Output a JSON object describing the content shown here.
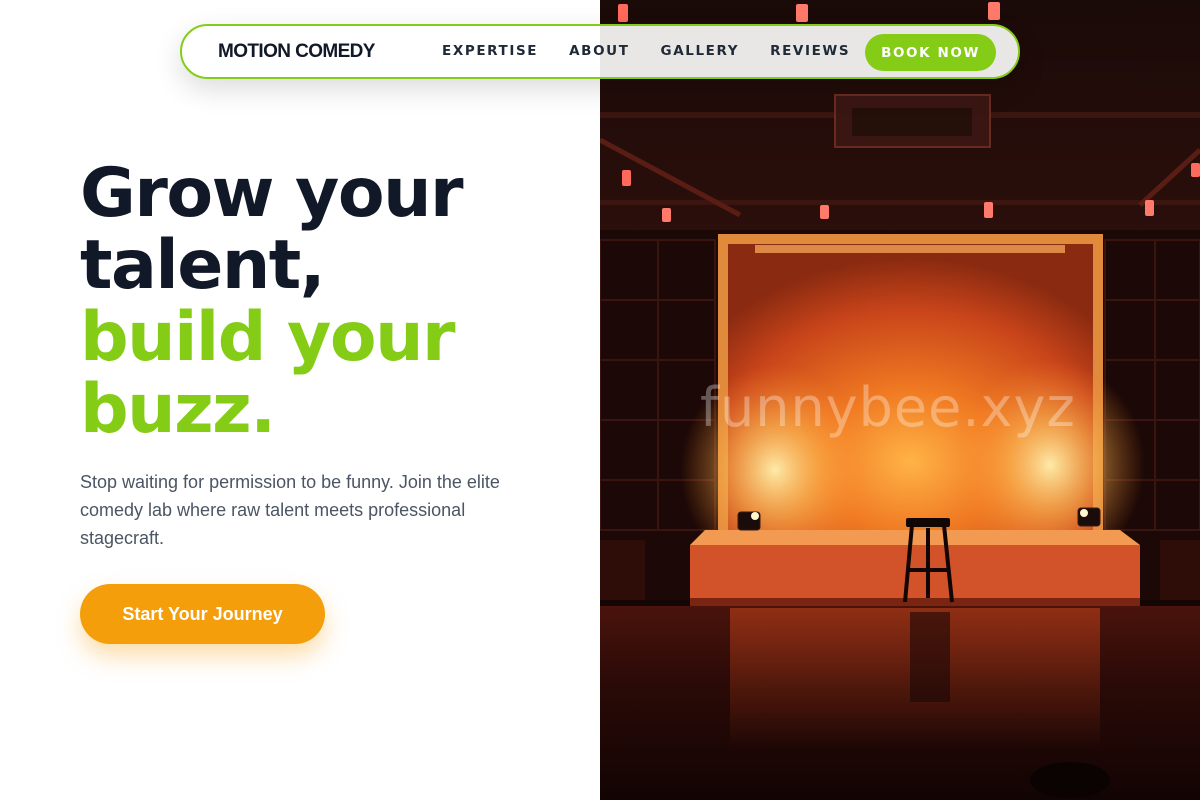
{
  "brand": {
    "name": "MOTION COMEDY"
  },
  "nav": {
    "links": [
      "EXPERTISE",
      "ABOUT",
      "GALLERY",
      "REVIEWS"
    ],
    "cta_label": "BOOK NOW"
  },
  "hero": {
    "headline_lines": [
      "Grow your",
      "talent,",
      "build your",
      "buzz."
    ],
    "highlight_color": "#84cc16",
    "subtext": "Stop waiting for permission to be funny. Join the elite comedy lab where raw talent meets professional stagecraft.",
    "cta_label": "Start Your Journey",
    "cta_color": "#f59e0b"
  },
  "photo": {
    "subject": "empty comedy stage with stool under orange spotlights",
    "watermark": "funnybee.xyz"
  },
  "colors": {
    "accent_green": "#84cc16",
    "accent_orange": "#f59e0b",
    "text_dark": "#111827",
    "text_muted": "#4b5563"
  }
}
